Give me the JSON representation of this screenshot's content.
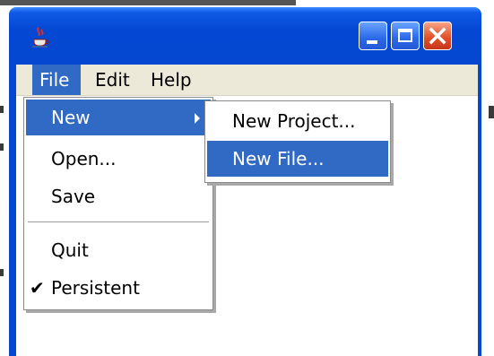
{
  "menubar": {
    "items": [
      {
        "label": "File"
      },
      {
        "label": "Edit"
      },
      {
        "label": "Help"
      }
    ]
  },
  "file_menu": {
    "items": [
      {
        "label": "New",
        "selected": true,
        "submenu": true
      },
      {
        "label": "Open..."
      },
      {
        "label": "Save"
      },
      {
        "label": "Quit"
      },
      {
        "label": "Persistent",
        "checked": true
      }
    ],
    "check_glyph": "✔"
  },
  "new_submenu": {
    "items": [
      {
        "label": "New Project..."
      },
      {
        "label": "New File...",
        "selected": true
      }
    ]
  },
  "title_buttons": [
    "minimize-icon",
    "maximize-icon",
    "close-icon"
  ],
  "colors": {
    "title_bar": "#0547d0",
    "menu_highlight": "#316ac5",
    "menubar_bg": "#ece9d8",
    "close_button": "#e2512a"
  }
}
